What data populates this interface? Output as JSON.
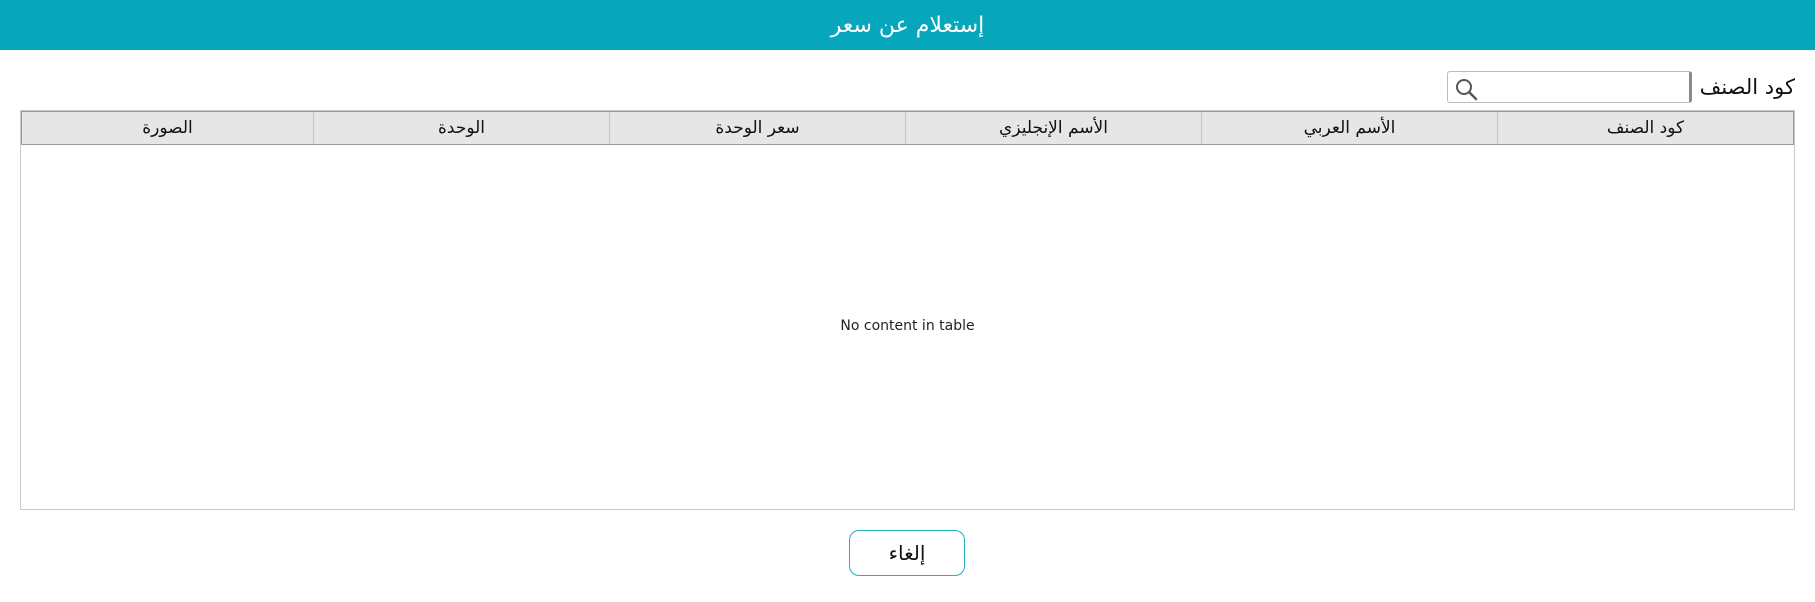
{
  "window": {
    "title": "إستعلام عن سعر"
  },
  "search": {
    "label": "كود الصنف",
    "value": "",
    "placeholder": "",
    "icon": "search-icon"
  },
  "table": {
    "columns": [
      "كود الصنف",
      "الأسم العربي",
      "الأسم الإنجليزي",
      "سعر الوحدة",
      "الوحدة",
      "الصورة"
    ],
    "rows": [],
    "empty_message": "No content in table"
  },
  "actions": {
    "cancel_label": "إلغاء"
  },
  "colors": {
    "accent": "#06a6bd",
    "header_bg": "#e6e6e6",
    "button_border": "#1fb0c4"
  }
}
